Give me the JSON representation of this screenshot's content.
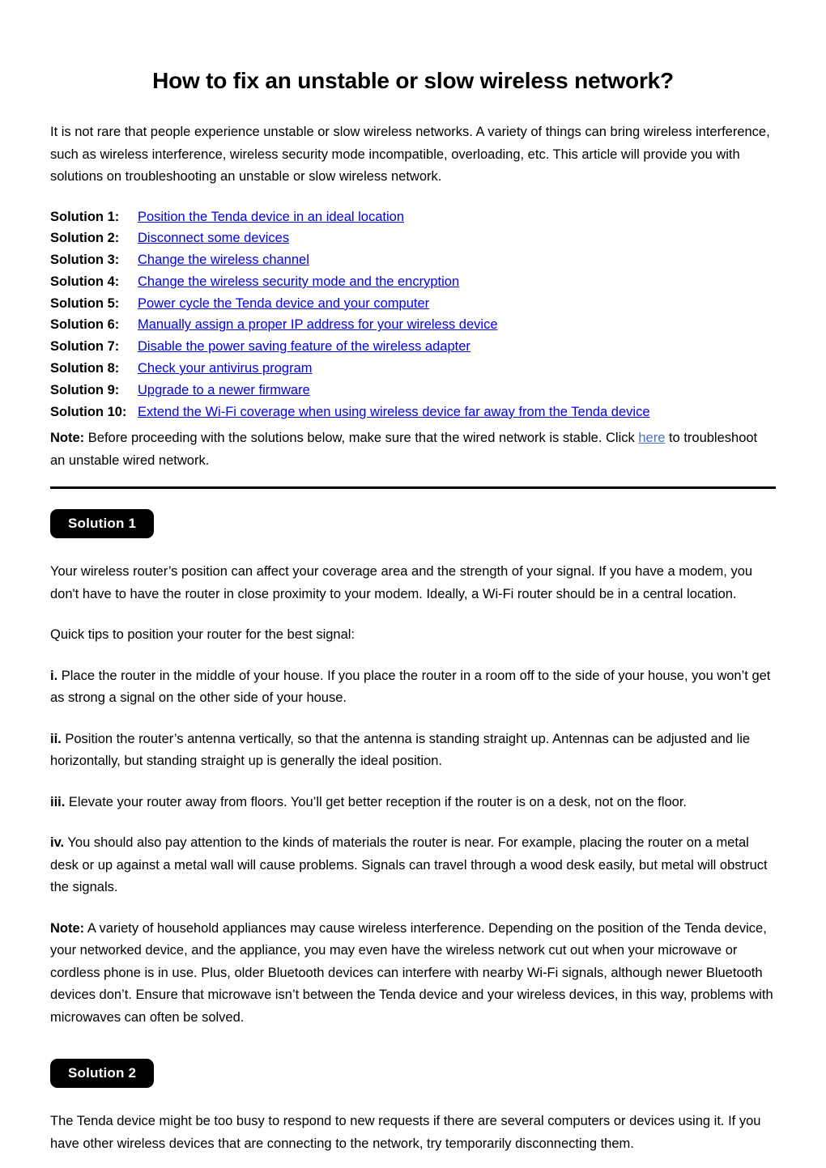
{
  "document": {
    "title": "How to fix an unstable or slow wireless network?",
    "intro": "It is not rare that people experience unstable or slow wireless networks. A variety of things can bring wireless interference, such as wireless interference, wireless security mode incompatible, overloading, etc. This article will provide you with solutions on troubleshooting an unstable or slow wireless network."
  },
  "colors": {
    "link": "#0000EE",
    "inline_link": "#4472C4",
    "badge_bg": "#000000",
    "badge_text": "#FFFFFF",
    "text": "#000000",
    "background": "#FFFFFF"
  },
  "solutions_index": [
    {
      "label": "Solution 1:",
      "link": "Position the Tenda device in an ideal location"
    },
    {
      "label": "Solution 2:",
      "link": "Disconnect some devices"
    },
    {
      "label": "Solution 3:",
      "link": "Change the wireless channel"
    },
    {
      "label": "Solution 4:",
      "link": "Change the wireless security mode and the encryption"
    },
    {
      "label": "Solution 5:",
      "link": "Power cycle the Tenda device and your computer"
    },
    {
      "label": "Solution 6:",
      "link": "Manually assign a proper IP address for your wireless device"
    },
    {
      "label": "Solution 7:",
      "link": "Disable the power saving feature of the wireless adapter"
    },
    {
      "label": "Solution 8:",
      "link": "Check your antivirus program"
    },
    {
      "label": "Solution 9:",
      "link": "Upgrade to a newer firmware"
    },
    {
      "label": "Solution 10:",
      "link": "Extend the Wi-Fi coverage when using wireless device far away from the Tenda device"
    }
  ],
  "index_note": {
    "lead": "Note:",
    "before_link": " Before proceeding with the solutions below, make sure that the wired network is stable. Click ",
    "link_text": "here",
    "after_link": " to troubleshoot an unstable wired network."
  },
  "section1": {
    "badge": "Solution 1",
    "para1": "Your wireless router’s position can affect your coverage area and the strength of your signal. If you have a modem, you don't have to have the router in close proximity to your modem. Ideally, a Wi-Fi router should be in a central location.",
    "para2": "Quick tips to position your router for the best signal:",
    "steps": [
      {
        "marker": "i.",
        "text": " Place the router in the middle of your house. If you place the router in a room off to the side of your house, you won’t get as strong a signal on the other side of your house."
      },
      {
        "marker": "ii.",
        "text": " Position the router’s antenna vertically, so that the antenna is standing straight up. Antennas can be adjusted and lie horizontally, but standing straight up is generally the ideal position."
      },
      {
        "marker": "iii.",
        "text": " Elevate your router away from floors. You’ll get better reception if the router is on a desk, not on the floor."
      },
      {
        "marker": "iv.",
        "text": " You should also pay attention to the kinds of materials the router is near. For example, placing the router on a metal desk or up against a metal wall will cause problems. Signals can travel through a wood desk easily, but metal will obstruct the signals."
      }
    ],
    "note": {
      "lead": "Note:",
      "text": " A variety of household appliances may cause wireless interference. Depending on the position of the Tenda device, your networked device, and the appliance, you may even have the wireless network cut out when your microwave or cordless phone is in use. Plus, older Bluetooth devices can interfere with nearby Wi-Fi signals, although newer Bluetooth devices don’t. Ensure that microwave isn’t between the Tenda device and your wireless devices, in this way, problems with microwaves can often be solved."
    }
  },
  "section2": {
    "badge": "Solution 2",
    "para1": "The Tenda device might be too busy to respond to new requests if there are several computers or devices using it. If you have other wireless devices that are connecting to the network, try temporarily disconnecting them."
  }
}
